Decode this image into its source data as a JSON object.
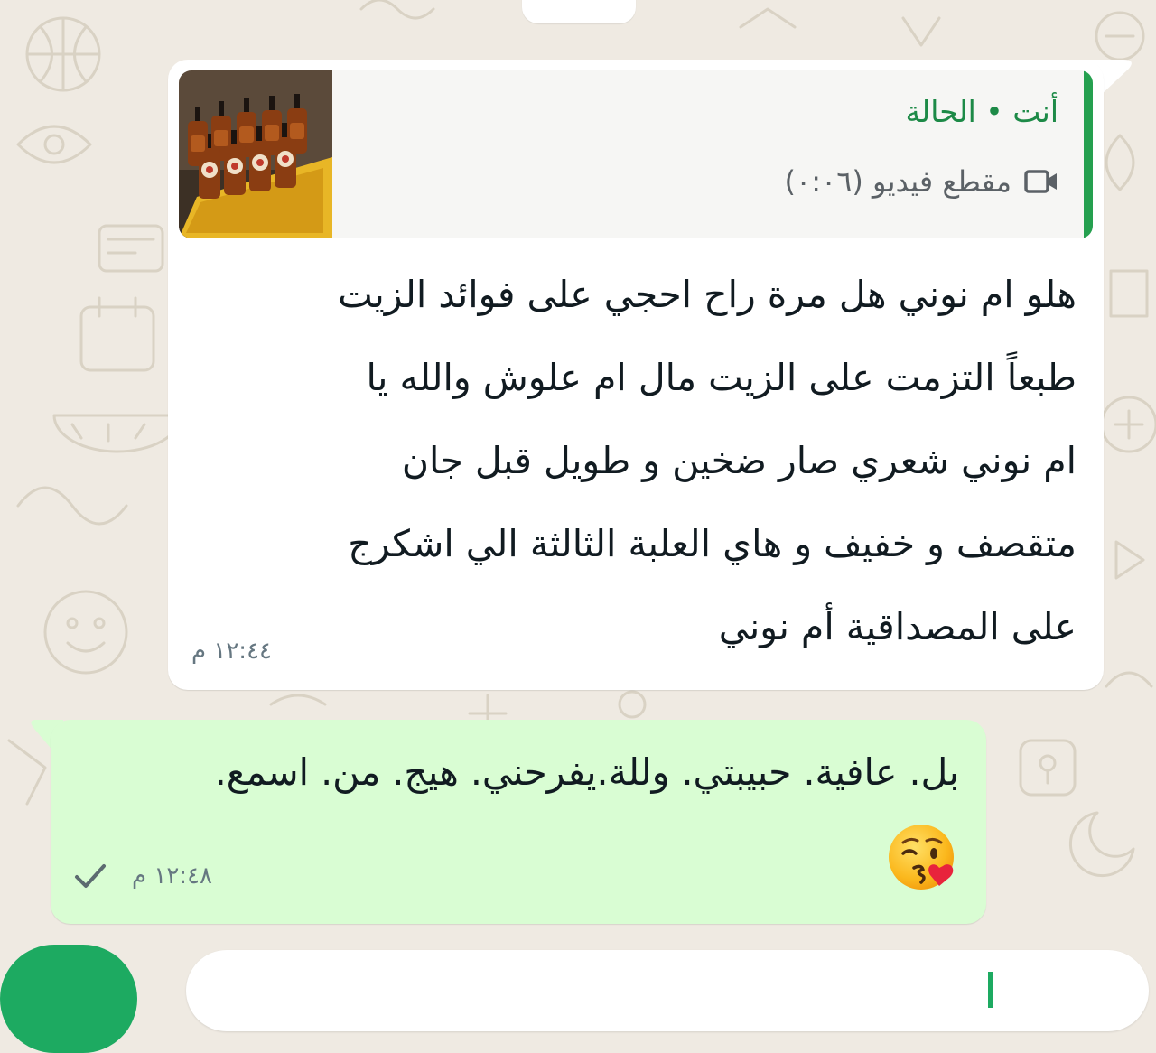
{
  "colors": {
    "wallpaper": "#efeae2",
    "incoming_bubble": "#ffffff",
    "outgoing_bubble": "#d9fdd3",
    "accent_green": "#25a04f",
    "quote_author": "#1d8a47",
    "timestamp": "#667781",
    "text": "#111b21"
  },
  "incoming_message": {
    "quote": {
      "author": "أنت • الحالة",
      "media_label": "مقطع فيديو (٠:٠٦)",
      "media_icon": "video-camera-icon",
      "thumbnail": "bottles-photo"
    },
    "lines": [
      "هلو ام نوني هل مرة راح احجي على فوائد الزيت",
      "طبعاً التزمت على الزيت مال ام علوش والله يا",
      "ام نوني شعري صار ضخين و طويل قبل جان",
      "متقصف و خفيف و هاي العلبة الثالثة الي اشكرج",
      "على المصداقية أم نوني"
    ],
    "time": "١٢:٤٤ م"
  },
  "outgoing_message": {
    "text": "بل. عافية. حبيبتي. وللة.يفرحني. هيج. من. اسمع.",
    "emoji": "face-blowing-kiss-emoji",
    "time": "١٢:٤٨ م",
    "status_icon": "single-check-icon"
  }
}
